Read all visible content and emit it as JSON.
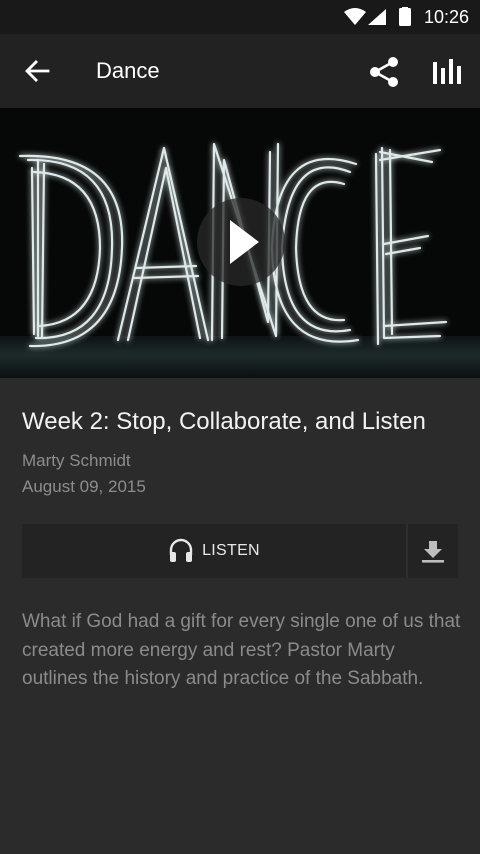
{
  "status_bar": {
    "time": "10:26",
    "icons": [
      "wifi-icon",
      "signal-icon",
      "battery-icon"
    ]
  },
  "app_bar": {
    "title": "Dance",
    "icons": [
      "back-arrow-icon",
      "share-icon",
      "stats-icon"
    ]
  },
  "hero": {
    "image_text": "DANCE",
    "icon": "play-icon"
  },
  "sermon": {
    "title": "Week 2: Stop, Collaborate, and Listen",
    "speaker": "Marty Schmidt",
    "date": "August 09, 2015"
  },
  "actions": {
    "listen_label": "LISTEN",
    "listen_icon": "headphones-icon",
    "download_icon": "download-icon"
  },
  "description": "What if God had a gift for every single one of us that created more energy and rest? Pastor Marty outlines the history and practice of the Sabbath.",
  "colors": {
    "background": "#2b2b2b",
    "app_bar": "#222222",
    "status_bar": "#191919",
    "muted_text": "#8d8d8d"
  }
}
